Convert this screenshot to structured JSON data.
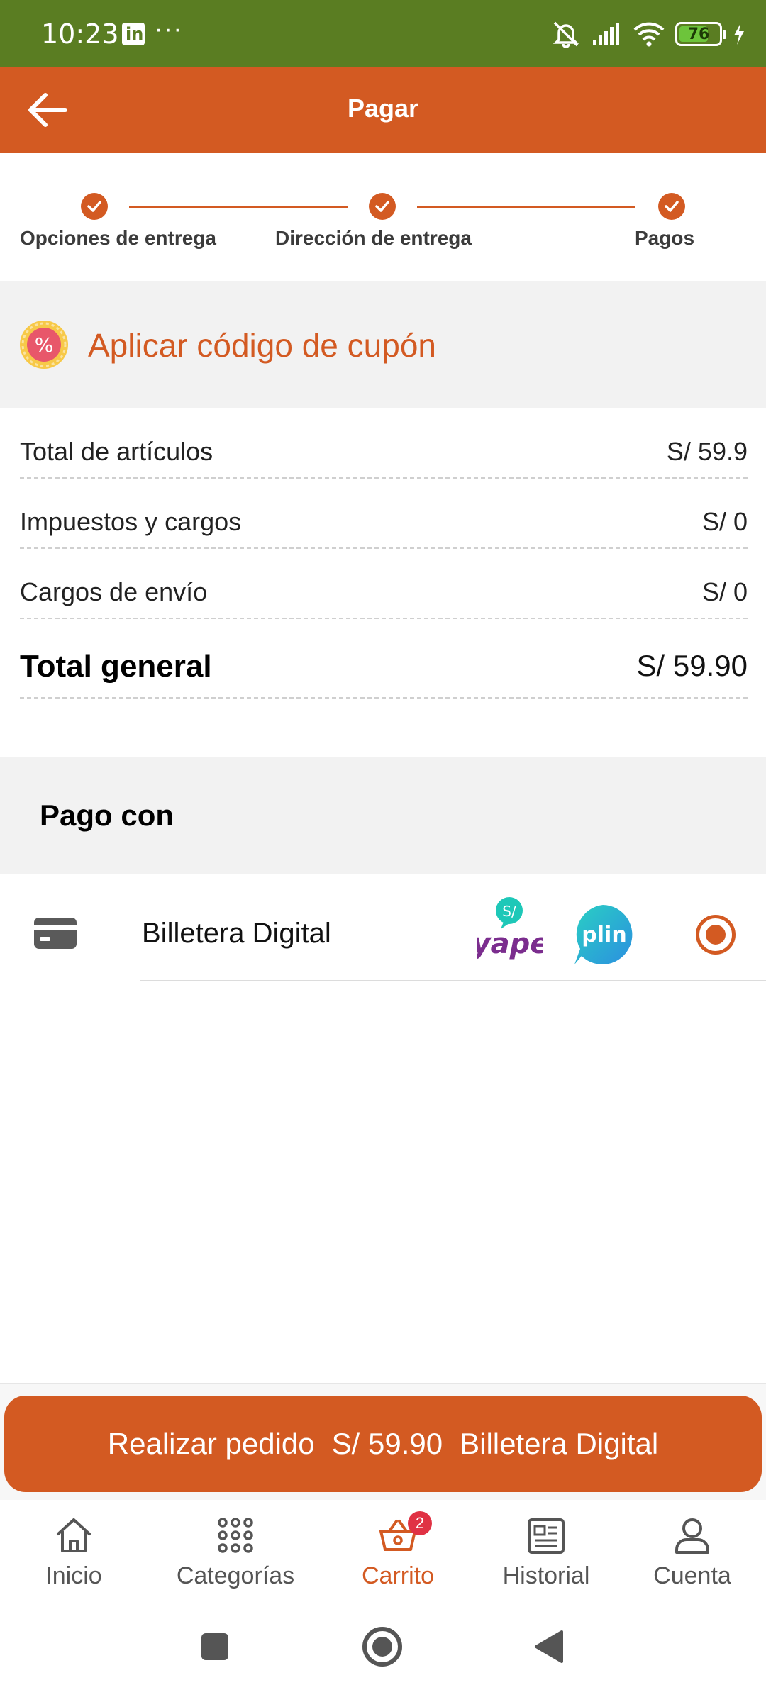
{
  "status_bar": {
    "time": "10:23",
    "dots": "···",
    "battery_level": "76",
    "icons": [
      "linkedin-icon",
      "more-icon",
      "silent-icon",
      "signal-icon",
      "wifi-icon",
      "battery-icon",
      "charging-icon"
    ]
  },
  "header": {
    "title": "Pagar"
  },
  "stepper": {
    "steps": [
      {
        "label": "Opciones de entrega"
      },
      {
        "label": "Dirección de entrega"
      },
      {
        "label": "Pagos"
      }
    ]
  },
  "coupon": {
    "label": "Aplicar código de cupón",
    "icon_symbol": "%"
  },
  "summary": {
    "rows": [
      {
        "label": "Total de artículos",
        "value": "S/ 59.9"
      },
      {
        "label": "Impuestos y cargos",
        "value": "S/ 0"
      },
      {
        "label": "Cargos de envío",
        "value": "S/ 0"
      }
    ],
    "total": {
      "label": "Total general",
      "value": "S/ 59.90"
    }
  },
  "payment": {
    "section_title": "Pago con",
    "method_label": "Billetera Digital",
    "yape_badge": "S/",
    "yape_text": "yape",
    "plin_text": "plin",
    "selected": true
  },
  "order": {
    "action": "Realizar pedido",
    "amount": "S/ 59.90",
    "method": "Billetera Digital"
  },
  "nav": {
    "items": [
      {
        "label": "Inicio"
      },
      {
        "label": "Categorías"
      },
      {
        "label": "Carrito",
        "badge": "2"
      },
      {
        "label": "Historial"
      },
      {
        "label": "Cuenta"
      }
    ],
    "active": "Carrito"
  },
  "colors": {
    "status_bar": "#5a7d22",
    "brand": "#d35a22",
    "section_bg": "#f2f2f2",
    "badge": "#e03244",
    "yape": "#7b2d8e",
    "plin": "#2ba7d8"
  }
}
